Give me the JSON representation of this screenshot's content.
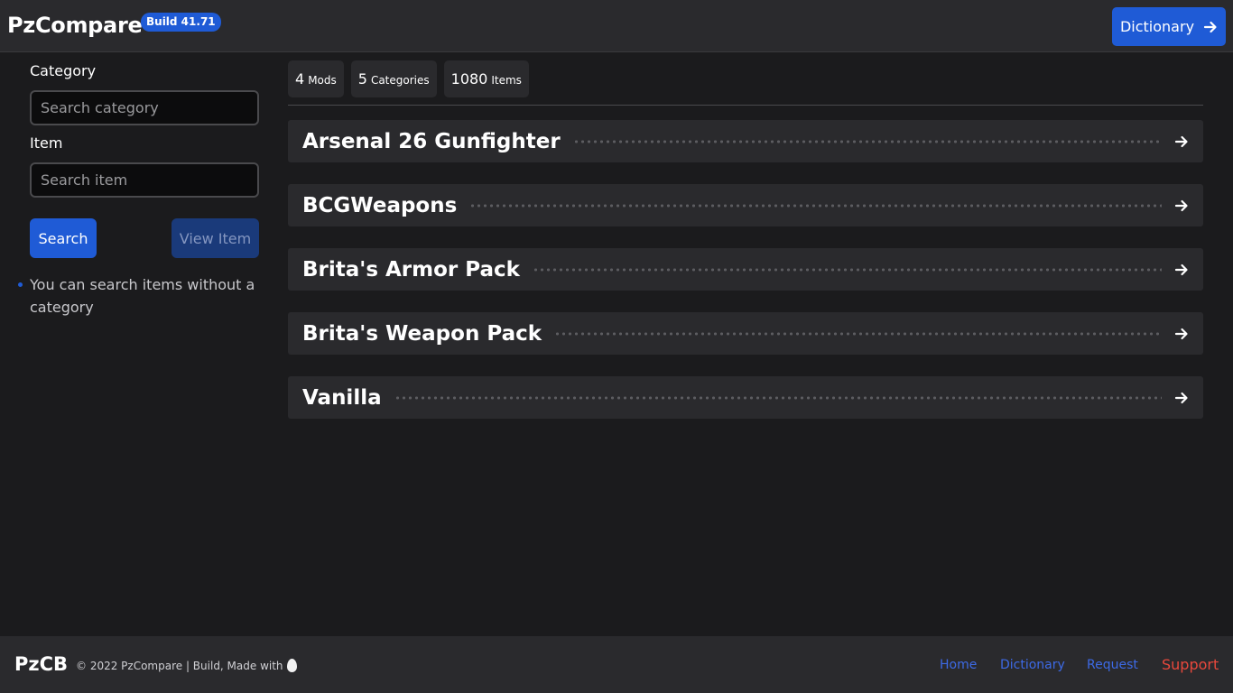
{
  "header": {
    "brand": "PzCompare",
    "build_badge": "Build 41.71",
    "dictionary_button": "Dictionary"
  },
  "sidebar": {
    "category_label": "Category",
    "category_placeholder": "Search category",
    "item_label": "Item",
    "item_placeholder": "Search item",
    "search_button": "Search",
    "view_item_button": "View Item",
    "tips": [
      "You can search items without a category"
    ]
  },
  "stats": [
    {
      "value": "4",
      "label": "Mods"
    },
    {
      "value": "5",
      "label": "Categories"
    },
    {
      "value": "1080",
      "label": "Items"
    }
  ],
  "mods": [
    {
      "name": "Arsenal 26 Gunfighter"
    },
    {
      "name": "BCGWeapons"
    },
    {
      "name": "Brita's Armor Pack"
    },
    {
      "name": "Brita's Weapon Pack"
    },
    {
      "name": "Vanilla"
    }
  ],
  "footer": {
    "brand": "PzCB",
    "copyright": "© 2022 PzCompare | Build, Made with",
    "links": {
      "home": "Home",
      "dictionary": "Dictionary",
      "request": "Request",
      "support": "Support"
    }
  },
  "colors": {
    "accent": "#1f5bd6",
    "background": "#1b1b1d",
    "panel": "#2a2a2d",
    "support": "#e8483c"
  }
}
